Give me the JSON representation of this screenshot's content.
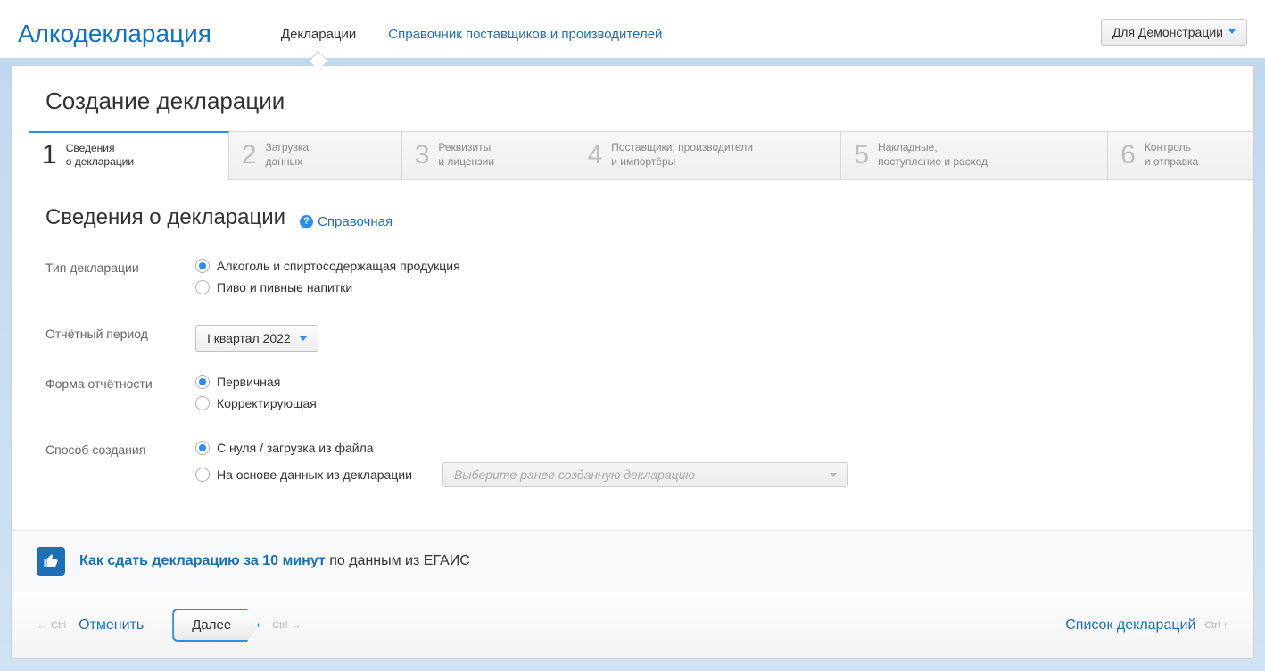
{
  "header": {
    "app_title": "Алкодекларация",
    "nav": [
      {
        "label": "Декларации",
        "active": true
      },
      {
        "label": "Справочник поставщиков и производителей",
        "active": false
      }
    ],
    "user_menu": "Для Демонстрации"
  },
  "page": {
    "title": "Создание декларации",
    "steps": [
      {
        "num": "1",
        "line1": "Сведения",
        "line2": "о декларации"
      },
      {
        "num": "2",
        "line1": "Загрузка",
        "line2": "данных"
      },
      {
        "num": "3",
        "line1": "Реквизиты",
        "line2": "и лицензии"
      },
      {
        "num": "4",
        "line1": "Поставщики, производители",
        "line2": "и импортёры"
      },
      {
        "num": "5",
        "line1": "Накладные,",
        "line2": "поступление и расход"
      },
      {
        "num": "6",
        "line1": "Контроль",
        "line2": "и отправка"
      }
    ],
    "section_title": "Сведения о декларации",
    "help_link": "Справочная"
  },
  "form": {
    "type_label": "Тип декларации",
    "type_options": {
      "alcohol": "Алкоголь и спиртосодержащая продукция",
      "beer": "Пиво и пивные напитки"
    },
    "period_label": "Отчётный период",
    "period_value": "I квартал 2022",
    "kind_label": "Форма отчётности",
    "kind_options": {
      "primary": "Первичная",
      "correcting": "Корректирующая"
    },
    "method_label": "Способ создания",
    "method_options": {
      "scratch": "С нуля / загрузка из файла",
      "based": "На основе данных из декларации"
    },
    "based_placeholder": "Выберите ранее созданную декларацию"
  },
  "promo": {
    "link_bold": "Как сдать декларацию за 10 минут",
    "suffix": " по данным из ЕГАИС"
  },
  "footer": {
    "ctrl": "Ctrl",
    "cancel": "Отменить",
    "next": "Далее",
    "list": "Список деклараций"
  }
}
